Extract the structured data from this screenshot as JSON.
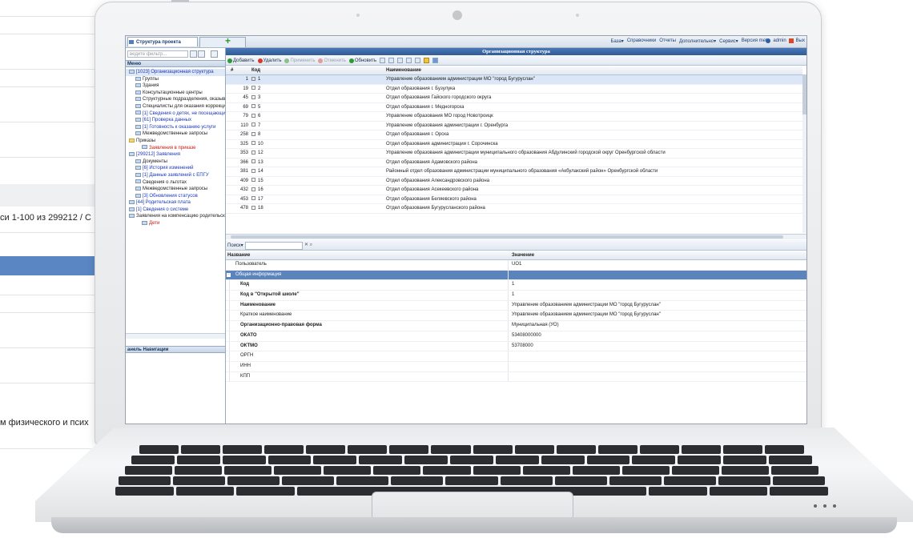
{
  "background_page": {
    "records_text": "си 1-100 из 299212 / С",
    "bottom_text": "м физического и псих"
  },
  "app": {
    "tab_label": "Структура проекта",
    "add_tab": "+",
    "top_menu": [
      "База▾",
      "Справочники",
      "Отчеты",
      "Дополнительно▾",
      "Сервис▾",
      "Версия meta"
    ],
    "user": "admin",
    "exit": "Вых"
  },
  "left": {
    "filter_placeholder": "ведите фильтр...",
    "menu_header": "Меню",
    "nav_header": "анель Навигации",
    "tree": [
      {
        "label": "[1023] Организационная структура",
        "cls": "blue sel",
        "indent": 0
      },
      {
        "label": "Группы",
        "cls": "",
        "indent": 1
      },
      {
        "label": "Здания",
        "cls": "",
        "indent": 1
      },
      {
        "label": "Консультационные центры",
        "cls": "",
        "indent": 1
      },
      {
        "label": "Структурные подразделения, оказыва",
        "cls": "",
        "indent": 1
      },
      {
        "label": "Специалисты для оказания коррекцио",
        "cls": "",
        "indent": 1
      },
      {
        "label": "[1] Сведения о детях, не посещающих",
        "cls": "blue",
        "indent": 1
      },
      {
        "label": "[61] Проверка данных",
        "cls": "blue",
        "indent": 1
      },
      {
        "label": "[1] Готовность к оказанию услуги",
        "cls": "blue",
        "indent": 1
      },
      {
        "label": "Межведомственные запросы",
        "cls": "",
        "indent": 1
      },
      {
        "label": "Приказы",
        "cls": "folder",
        "indent": 0
      },
      {
        "label": "Заявления в приказе",
        "cls": "red",
        "indent": 2
      },
      {
        "label": "[299212] Заявления",
        "cls": "blue",
        "indent": 0
      },
      {
        "label": "Документы",
        "cls": "",
        "indent": 1
      },
      {
        "label": "[6] История изменений",
        "cls": "blue",
        "indent": 1
      },
      {
        "label": "[1] Данные заявлений с ЕПГУ",
        "cls": "blue",
        "indent": 1
      },
      {
        "label": "Сведения о льготах",
        "cls": "",
        "indent": 1
      },
      {
        "label": "Межведомственные запросы",
        "cls": "",
        "indent": 1
      },
      {
        "label": "[3] Обновления статусов",
        "cls": "blue",
        "indent": 1
      },
      {
        "label": "[44] Родительская плата",
        "cls": "blue",
        "indent": 0
      },
      {
        "label": "[1] Сведения о системе",
        "cls": "blue",
        "indent": 0
      },
      {
        "label": "Заявления на компенсацию родительско",
        "cls": "",
        "indent": 0
      },
      {
        "label": "Дети",
        "cls": "red",
        "indent": 2
      }
    ]
  },
  "main": {
    "title": "Организационная структура",
    "toolbar": [
      {
        "label": "Добавить",
        "color": "#2d9a35",
        "dis": false
      },
      {
        "label": "Удалить",
        "color": "#d43a2a",
        "dis": false
      },
      {
        "label": "Применить",
        "color": "#8cc08c",
        "dis": true
      },
      {
        "label": "Отменить",
        "color": "#e39b9b",
        "dis": true
      },
      {
        "label": "Обновить",
        "color": "#2d9a35",
        "dis": false
      }
    ],
    "columns": {
      "hash": "#",
      "code": "Код",
      "name": "Наименование"
    },
    "rows": [
      {
        "num": "1",
        "code": "1",
        "name": "Управление образованием администрации МО \"город Бугуруслан\""
      },
      {
        "num": "19",
        "code": "2",
        "name": "Отдел образования г. Бузулука"
      },
      {
        "num": "45",
        "code": "3",
        "name": "Отдел образования Гайского городского округа"
      },
      {
        "num": "69",
        "code": "5",
        "name": "Отдел образования г. Медногорска"
      },
      {
        "num": "79",
        "code": "6",
        "name": "Управление образования МО город Новотроицк"
      },
      {
        "num": "110",
        "code": "7",
        "name": "Управление образования администрации г. Оренбурга"
      },
      {
        "num": "258",
        "code": "8",
        "name": "Отдел образования г. Орска"
      },
      {
        "num": "325",
        "code": "10",
        "name": "Отдел образования администрации г. Сорочинска"
      },
      {
        "num": "353",
        "code": "12",
        "name": "Управление образования администрации муниципального образования Абдулинский городской округ Оренбургской области"
      },
      {
        "num": "366",
        "code": "13",
        "name": "Отдел образования Адамовского района"
      },
      {
        "num": "381",
        "code": "14",
        "name": "Районный отдел образования администрации муниципального образования «Акбулакский район» Оренбургской области"
      },
      {
        "num": "409",
        "code": "15",
        "name": "Отдел образования Александровского района"
      },
      {
        "num": "432",
        "code": "16",
        "name": "Отдел образования Асекеевского района"
      },
      {
        "num": "453",
        "code": "17",
        "name": "Отдел образования Беляевского района"
      },
      {
        "num": "478",
        "code": "18",
        "name": "Отдел образования Бугурусланского района"
      }
    ],
    "search_label": "Поиск▾",
    "props_columns": {
      "name": "Название",
      "value": "Значение"
    },
    "props": [
      {
        "name": "Пользователь",
        "value": "UO1",
        "type": "plain"
      },
      {
        "name": "Общая информация",
        "value": "",
        "type": "group"
      },
      {
        "name": "Код",
        "value": "1",
        "type": "bold"
      },
      {
        "name": "Код в \"Открытой школе\"",
        "value": "1",
        "type": "bold"
      },
      {
        "name": "Наименование",
        "value": "Управление образованием администрации МО \"город Бугуруслан\"",
        "type": "bold"
      },
      {
        "name": "Краткое наименование",
        "value": "Управление образованием администрации МО \"город Бугуруслан\"",
        "type": "plain"
      },
      {
        "name": "Организационно-правовая форма",
        "value": "Муниципальная (УО)",
        "type": "bold"
      },
      {
        "name": "ОКАТО",
        "value": "53408000000",
        "type": "bold"
      },
      {
        "name": "ОКТМО",
        "value": "53708000",
        "type": "bold"
      },
      {
        "name": "ОРГН",
        "value": "",
        "type": "plain"
      },
      {
        "name": "ИНН",
        "value": "",
        "type": "plain"
      },
      {
        "name": "КПП",
        "value": "",
        "type": "plain"
      }
    ]
  }
}
